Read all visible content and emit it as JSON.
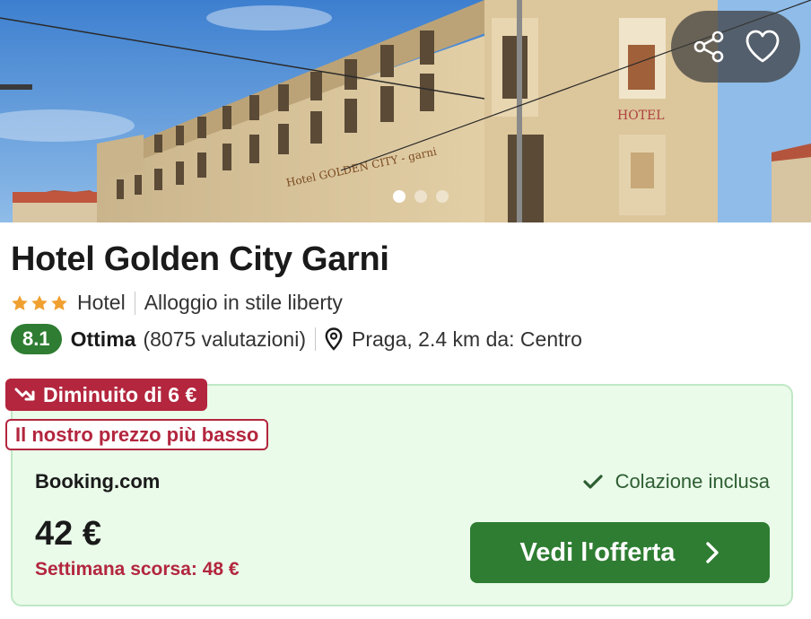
{
  "photo": {
    "alt_sign": "Hotel GOLDEN CITY - garni",
    "facade_sign": "HOTEL",
    "carousel": {
      "total": 3,
      "active": 1
    }
  },
  "actions": {
    "share_icon": "share-icon",
    "favorite_icon": "heart-icon"
  },
  "hotel": {
    "name": "Hotel Golden City Garni",
    "stars": 3,
    "type": "Hotel",
    "style": "Alloggio in stile liberty",
    "score": "8.1",
    "score_label": "Ottima",
    "reviews": "(8075 valutazioni)",
    "location": "Praga, 2.4 km da: Centro"
  },
  "offer": {
    "price_drop": "Diminuito di 6 €",
    "lowest_price": "Il nostro prezzo più basso",
    "provider": "Booking.com",
    "breakfast": "Colazione inclusa",
    "price": "42 €",
    "last_week": "Settimana scorsa: 48 €",
    "cta": "Vedi l'offerta"
  },
  "colors": {
    "accent_green": "#2e7d32",
    "alert_red": "#b3263e",
    "card_bg": "#eafbea",
    "star": "#f0a030"
  }
}
